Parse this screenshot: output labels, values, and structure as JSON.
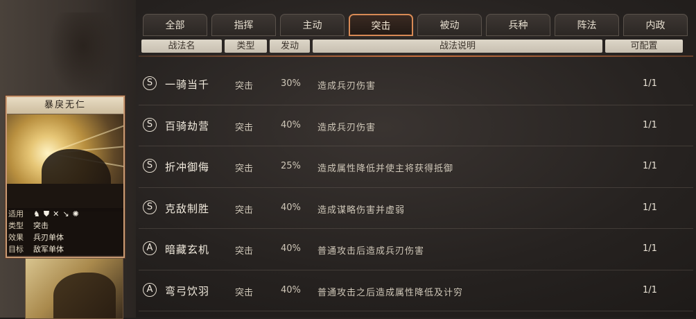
{
  "tabs": [
    {
      "label": "全部"
    },
    {
      "label": "指挥"
    },
    {
      "label": "主动"
    },
    {
      "label": "突击",
      "active": true
    },
    {
      "label": "被动"
    },
    {
      "label": "兵种"
    },
    {
      "label": "阵法"
    },
    {
      "label": "内政"
    }
  ],
  "headers": {
    "name": "战法名",
    "type": "类型",
    "rate": "发动",
    "desc": "战法说明",
    "avail": "可配置"
  },
  "tactics": [
    {
      "grade": "S",
      "name": "一骑当千",
      "type": "突击",
      "rate": "30%",
      "desc": "造成兵刃伤害",
      "avail": "1/1"
    },
    {
      "grade": "S",
      "name": "百骑劫营",
      "type": "突击",
      "rate": "40%",
      "desc": "造成兵刃伤害",
      "avail": "1/1"
    },
    {
      "grade": "S",
      "name": "折冲御侮",
      "type": "突击",
      "rate": "25%",
      "desc": "造成属性降低并使主将获得抵御",
      "avail": "1/1"
    },
    {
      "grade": "S",
      "name": "克敌制胜",
      "type": "突击",
      "rate": "40%",
      "desc": "造成谋略伤害并虚弱",
      "avail": "1/1"
    },
    {
      "grade": "A",
      "name": "暗藏玄机",
      "type": "突击",
      "rate": "40%",
      "desc": "普通攻击后造成兵刃伤害",
      "avail": "1/1"
    },
    {
      "grade": "A",
      "name": "弯弓饮羽",
      "type": "突击",
      "rate": "40%",
      "desc": "普通攻击之后造成属性降低及计穷",
      "avail": "1/1"
    }
  ],
  "card": {
    "title": "暴戾无仁",
    "stats": [
      {
        "key": "适用",
        "value": ""
      },
      {
        "key": "类型",
        "value": "突击"
      },
      {
        "key": "效果",
        "value": "兵刃单体"
      },
      {
        "key": "目标",
        "value": "敌军单体"
      }
    ],
    "unit_icons": [
      "cavalry-icon",
      "shield-icon",
      "bow-icon",
      "spear-icon",
      "siege-icon"
    ]
  },
  "colors": {
    "accent": "#d88a55",
    "header_bg": "#d2cbbd",
    "card_border": "#c99a73"
  }
}
